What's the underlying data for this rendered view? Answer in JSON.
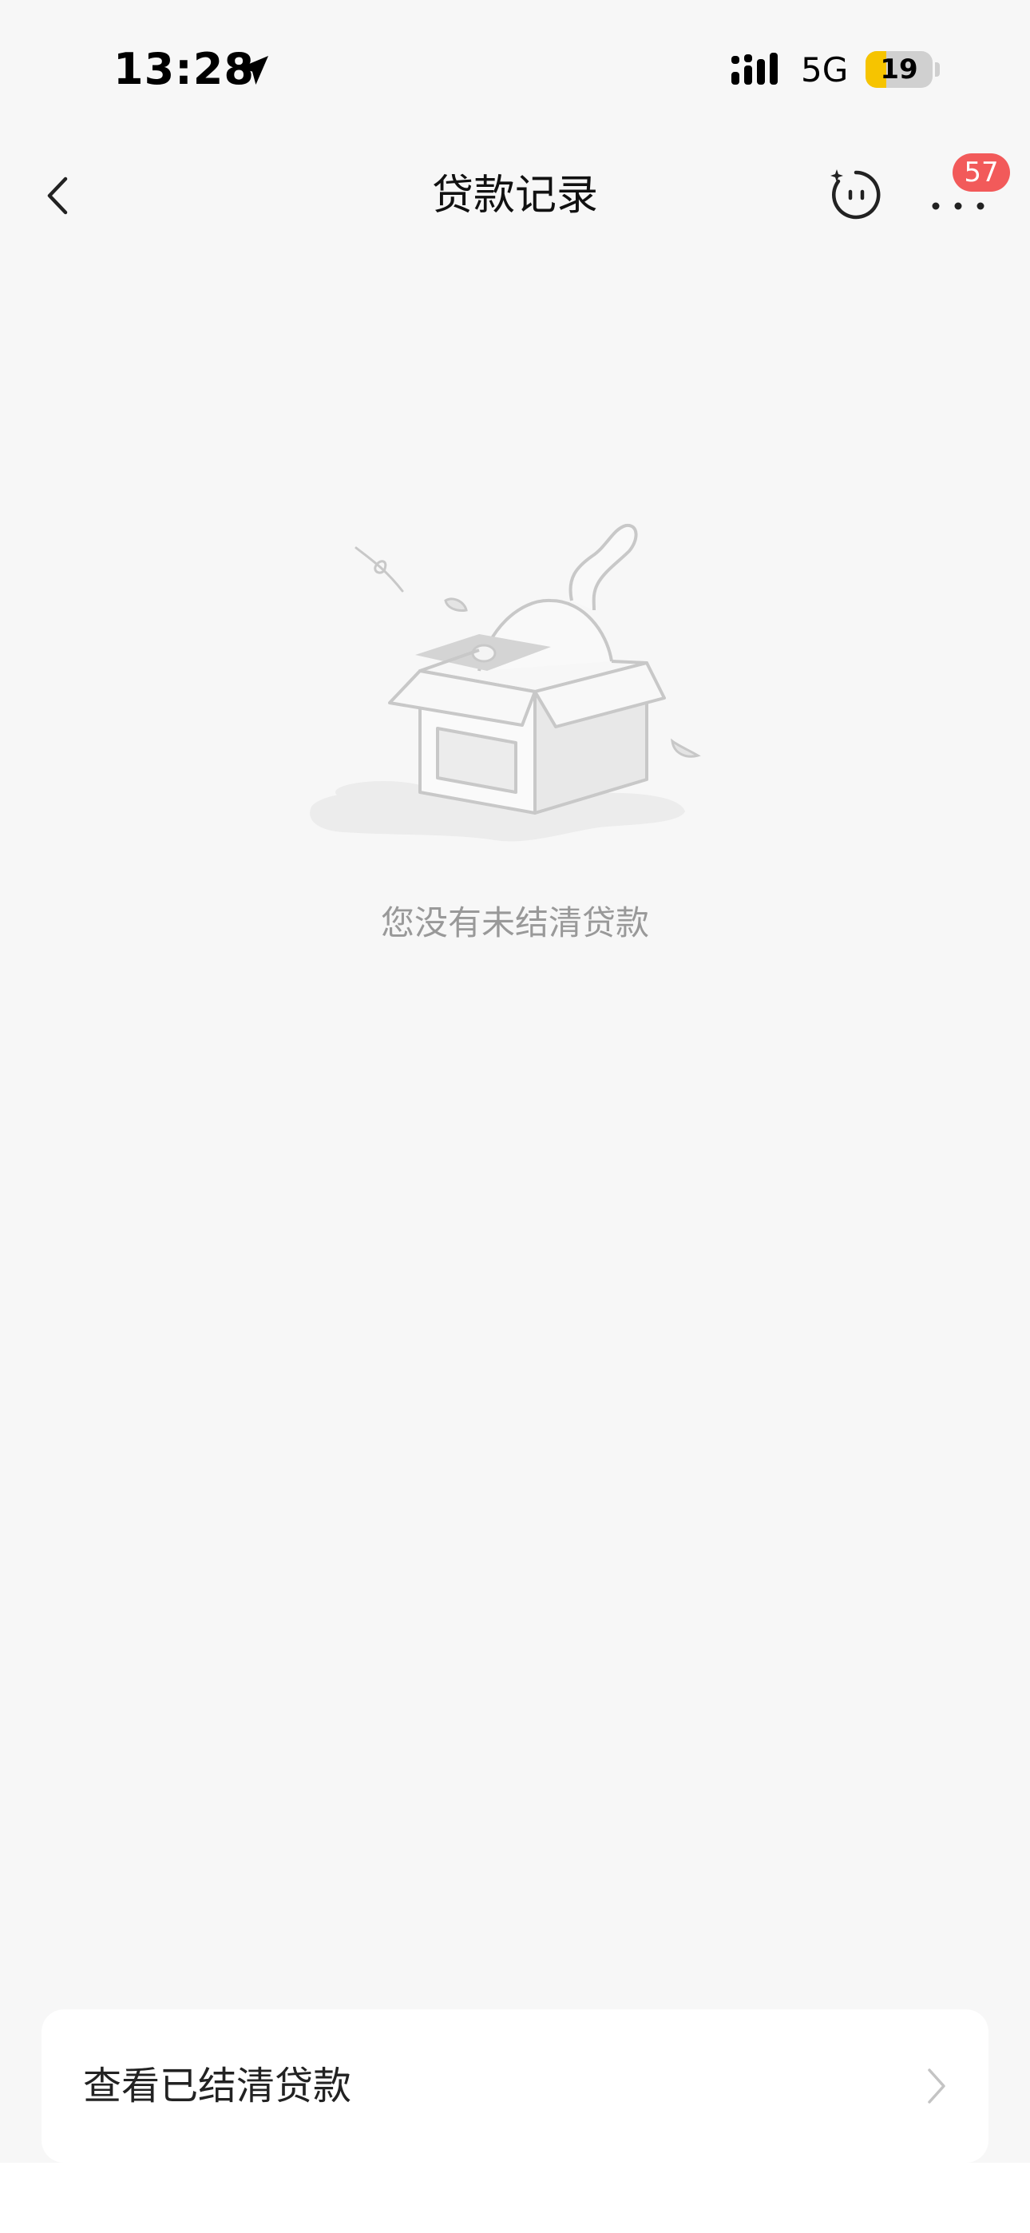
{
  "status_bar": {
    "time": "13:28",
    "network": "5G",
    "battery_level": "19",
    "battery_fraction": 0.19,
    "icons": [
      "location-arrow-icon",
      "signal-icon",
      "battery-icon"
    ]
  },
  "nav": {
    "title": "贷款记录",
    "badge_count": "57",
    "icons": [
      "chevron-left-icon",
      "assistant-face-icon",
      "more-dots-icon"
    ]
  },
  "empty_state": {
    "message": "您没有未结清贷款",
    "illustration": "empty-box-illustration"
  },
  "settled_entry": {
    "label": "查看已结清贷款",
    "icon": "chevron-right-icon"
  },
  "colors": {
    "background": "#f7f7f7",
    "card": "#ffffff",
    "badge": "#f25a5a",
    "battery_fill": "#f6c400",
    "muted_text": "#999999"
  }
}
